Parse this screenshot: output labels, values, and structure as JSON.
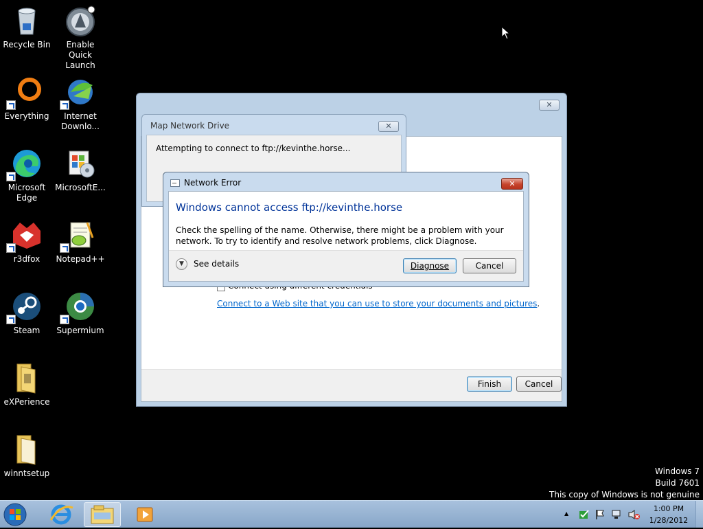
{
  "desktop": {
    "icons": [
      {
        "label": "Recycle Bin",
        "icon": "recycle-bin-icon"
      },
      {
        "label": "Enable Quick Launch",
        "icon": "quick-launch-icon"
      },
      {
        "label": "Everything",
        "icon": "everything-icon"
      },
      {
        "label": "Internet Downlo...",
        "icon": "internet-download-manager-icon"
      },
      {
        "label": "Microsoft Edge",
        "icon": "edge-icon"
      },
      {
        "label": "MicrosoftE...",
        "icon": "microsoft-installer-icon"
      },
      {
        "label": "r3dfox",
        "icon": "r3dfox-icon"
      },
      {
        "label": "Notepad++",
        "icon": "notepad-plus-plus-icon"
      },
      {
        "label": "Steam",
        "icon": "steam-icon"
      },
      {
        "label": "Supermium",
        "icon": "supermium-icon"
      },
      {
        "label": "eXPerience",
        "icon": "folder-icon"
      },
      {
        "label": "winntsetup",
        "icon": "folder-icon"
      }
    ]
  },
  "wizard": {
    "close_glyph": "✕",
    "checkbox_label_partial": "Connect using different credentials",
    "link_text": "Connect to a Web site that you can use to store your documents and pictures",
    "link_suffix": ".",
    "finish_label": "Finish",
    "cancel_label": "Cancel",
    "link_color": "#0066cc"
  },
  "map_drive_dialog": {
    "title": "Map Network Drive",
    "close_glyph": "✕",
    "message": "Attempting to connect to ftp://kevinthe.horse..."
  },
  "error_dialog": {
    "title": "Network Error",
    "close_glyph": "✕",
    "heading": "Windows cannot access ftp://kevinthe.horse",
    "body": "Check the spelling of the name. Otherwise, there might be a problem with your network. To try to identify and resolve network problems, click Diagnose.",
    "see_details_label": "See details",
    "diagnose_label": "Diagnose",
    "cancel_label": "Cancel",
    "heading_color": "#003399"
  },
  "watermark": {
    "line1": "Windows 7",
    "line2": "Build 7601",
    "line3": "This copy of Windows is not genuine"
  },
  "taskbar": {
    "items": [
      "start-orb-icon",
      "internet-explorer-icon",
      "file-explorer-icon",
      "media-player-icon"
    ],
    "tray": {
      "chevron": "▲",
      "time": "1:00 PM",
      "date": "1/28/2012"
    }
  }
}
